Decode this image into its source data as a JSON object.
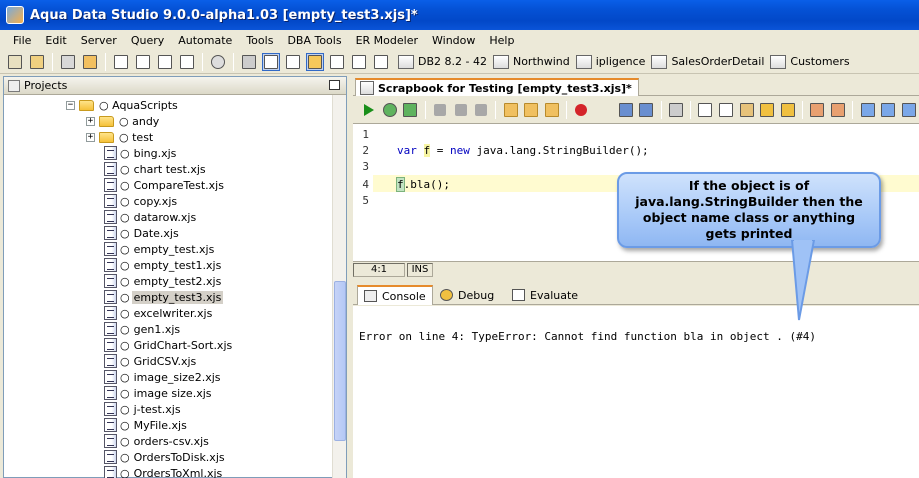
{
  "window": {
    "title": "Aqua Data Studio 9.0.0-alpha1.03 [empty_test3.xjs]*"
  },
  "menu": [
    "File",
    "Edit",
    "Server",
    "Query",
    "Automate",
    "Tools",
    "DBA Tools",
    "ER Modeler",
    "Window",
    "Help"
  ],
  "toolbar": {
    "links": [
      "DB2 8.2 - 42",
      "Northwind",
      "ipligence",
      "SalesOrderDetail",
      "Customers"
    ]
  },
  "projects": {
    "title": "Projects",
    "root": "AquaScripts",
    "folders": [
      "andy",
      "test"
    ],
    "files": [
      "bing.xjs",
      "chart test.xjs",
      "CompareTest.xjs",
      "copy.xjs",
      "datarow.xjs",
      "Date.xjs",
      "empty_test.xjs",
      "empty_test1.xjs",
      "empty_test2.xjs",
      "empty_test3.xjs",
      "excelwriter.xjs",
      "gen1.xjs",
      "GridChart-Sort.xjs",
      "GridCSV.xjs",
      "image_size2.xjs",
      "image size.xjs",
      "j-test.xjs",
      "MyFile.xjs",
      "orders-csv.xjs",
      "OrdersToDisk.xjs",
      "OrdersToXml.xjs"
    ],
    "selected": "empty_test3.xjs"
  },
  "editor": {
    "tab_title": "Scrapbook for Testing [empty_test3.xjs]*",
    "line_numbers": [
      "1",
      "2",
      "3",
      "4",
      "5"
    ],
    "code": {
      "line2_var": "var",
      "line2_f": "f",
      "line2_eq": " = ",
      "line2_new": "new",
      "line2_rest": " java.lang.StringBuilder();",
      "line4_f": "f",
      "line4_rest": ".bla();"
    },
    "status_position": "4:1",
    "status_mode": "INS"
  },
  "console": {
    "tabs": [
      "Console",
      "Debug",
      "Evaluate"
    ],
    "output": "Error on line 4: TypeError: Cannot find function bla in object . (#4)"
  },
  "callout": {
    "text": "If the object is of java.lang.StringBuilder then the object name class or anything gets printed"
  }
}
